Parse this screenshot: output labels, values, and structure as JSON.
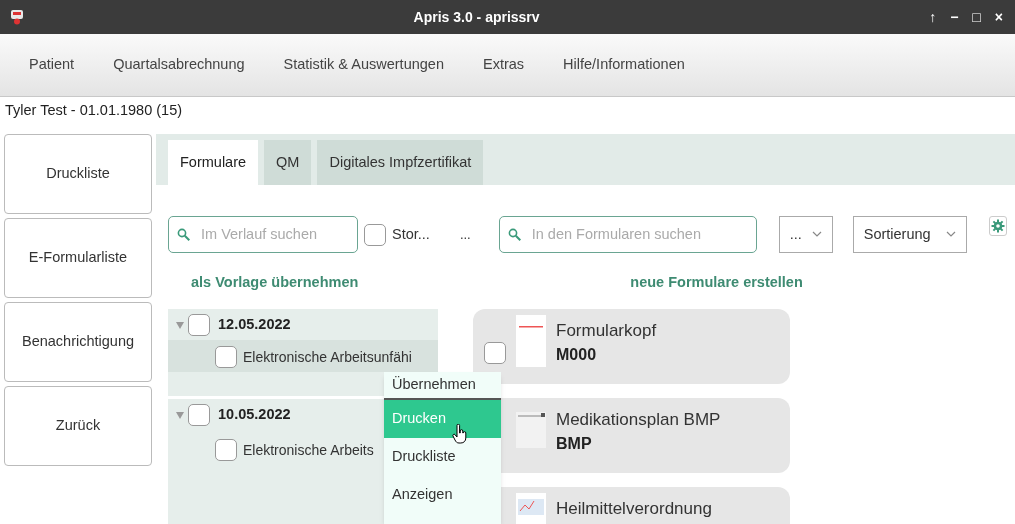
{
  "window": {
    "title": "Apris 3.0 - aprissrv",
    "controls": [
      "↑",
      "−",
      "□",
      "×"
    ]
  },
  "menu": [
    "Patient",
    "Quartalsabrechnung",
    "Statistik & Auswertungen",
    "Extras",
    "Hilfe/Informationen"
  ],
  "patient": "Tyler Test - 01.01.1980 (15)",
  "side_buttons": [
    "Druckliste",
    "E-Formularliste",
    "Benachrichtigung",
    "Zurück"
  ],
  "tabs": [
    {
      "label": "Formulare",
      "selected": true
    },
    {
      "label": "QM",
      "selected": false
    },
    {
      "label": "Digitales Impfzertifikat",
      "selected": false
    }
  ],
  "history_search": {
    "placeholder": "Im Verlauf suchen"
  },
  "storno": {
    "label": "Stor...",
    "checked": false
  },
  "more": "...",
  "form_search": {
    "placeholder": "In den Formularen suchen"
  },
  "filter_select": {
    "value": "..."
  },
  "sort_select": {
    "value": "Sortierung"
  },
  "left_heading": "als Vorlage übernehmen",
  "right_heading": "neue Formulare erstellen",
  "history": [
    {
      "date": "12.05.2022",
      "expanded": true,
      "checked": false,
      "children": [
        {
          "label": "Elektronische Arbeitsunfähi",
          "checked": false,
          "selected": true
        }
      ]
    },
    {
      "date": "10.05.2022",
      "expanded": true,
      "checked": false,
      "children": [
        {
          "label": "Elektronische Arbeits",
          "checked": false,
          "selected": false
        }
      ]
    }
  ],
  "forms": [
    {
      "name": "Formularkopf",
      "code": "M000",
      "checked": false
    },
    {
      "name": "Medikationsplan BMP",
      "code": "BMP"
    },
    {
      "name": "Heilmittelverordnung"
    }
  ],
  "context_menu": [
    {
      "label": "Übernehmen",
      "selected": false
    },
    {
      "label": "Drucken",
      "selected": true
    },
    {
      "label": "Druckliste",
      "selected": false
    },
    {
      "label": "Anzeigen",
      "selected": false
    }
  ]
}
